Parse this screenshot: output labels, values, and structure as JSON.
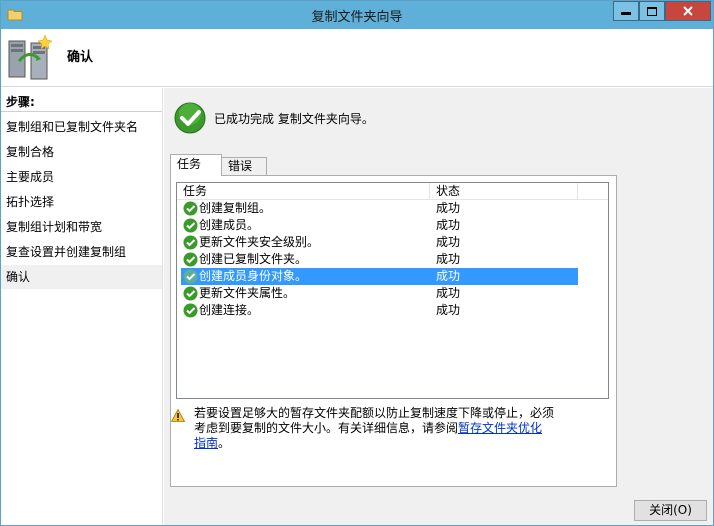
{
  "window": {
    "title": "复制文件夹向导"
  },
  "header": {
    "title": "确认"
  },
  "sidebar": {
    "heading": "步骤:",
    "items": [
      {
        "label": "复制组和已复制文件夹名"
      },
      {
        "label": "复制合格"
      },
      {
        "label": "主要成员"
      },
      {
        "label": "拓扑选择"
      },
      {
        "label": "复制组计划和带宽"
      },
      {
        "label": "复查设置并创建复制组"
      },
      {
        "label": "确认"
      }
    ]
  },
  "result": {
    "message": "已成功完成 复制文件夹向导。"
  },
  "tabs": [
    {
      "label": "任务"
    },
    {
      "label": "错误"
    }
  ],
  "task_list": {
    "columns": [
      "任务",
      "状态"
    ],
    "rows": [
      {
        "task": "创建复制组。",
        "status": "成功"
      },
      {
        "task": "创建成员。",
        "status": "成功"
      },
      {
        "task": "更新文件夹安全级别。",
        "status": "成功"
      },
      {
        "task": "创建已复制文件夹。",
        "status": "成功"
      },
      {
        "task": "创建成员身份对象。",
        "status": "成功"
      },
      {
        "task": "更新文件夹属性。",
        "status": "成功"
      },
      {
        "task": "创建连接。",
        "status": "成功"
      }
    ]
  },
  "warning": {
    "text_part1": "若要设置足够大的暂存文件夹配额以防止复制速度下降或停止，必须考虑到要复制的文件大小。有关详细信息，请参阅",
    "link_text": "暂存文件夹优化指南",
    "text_part2": "。"
  },
  "footer": {
    "close_label": "关闭(O)"
  },
  "colors": {
    "titlebar": "#5fb0d8",
    "selection": "#3399ff",
    "success_green": "#3a9a2a",
    "link": "#0033cc"
  }
}
